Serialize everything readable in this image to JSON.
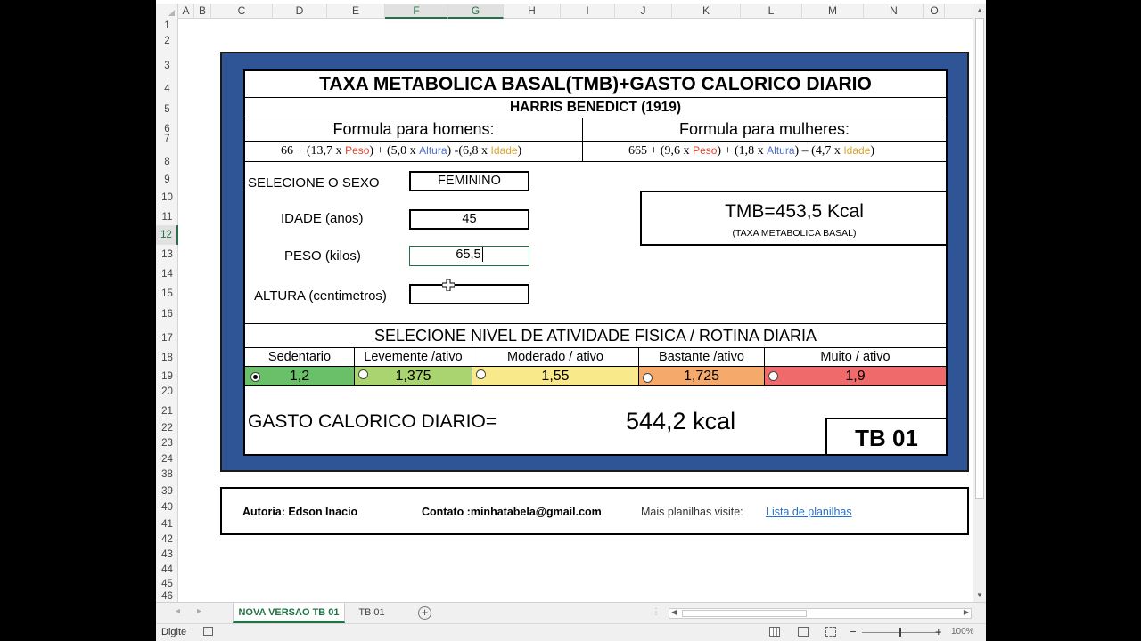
{
  "columns": [
    "A",
    "B",
    "C",
    "D",
    "E",
    "F",
    "G",
    "H",
    "I",
    "J",
    "K",
    "L",
    "M",
    "N",
    "O"
  ],
  "rows": [
    "1",
    "2",
    "3",
    "4",
    "5",
    "6",
    "7",
    "8",
    "9",
    "10",
    "11",
    "12",
    "13",
    "14",
    "15",
    "16",
    "17",
    "18",
    "19",
    "20",
    "21",
    "22",
    "23",
    "24",
    "38",
    "39",
    "40",
    "41",
    "42",
    "43",
    "44",
    "45",
    "46"
  ],
  "sheet": {
    "title": "TAXA METABOLICA BASAL(TMB)+GASTO CALORICO DIARIO",
    "subtitle": "HARRIS BENEDICT (1919)",
    "formula_men_label": "Formula para homens:",
    "formula_women_label": "Formula para mulheres:",
    "formula_men": {
      "p1": "66 + (13,7 x ",
      "peso": "Peso",
      "p2": ") + (5,0 x ",
      "altura": "Altura",
      "p3": ") -(6,8 x ",
      "idade": "Idade",
      "p4": ")"
    },
    "formula_women": {
      "p1": "665 + (9,6 x ",
      "peso": "Peso",
      "p2": ") + (1,8 x ",
      "altura": "Altura",
      "p3": ") – (4,7 x ",
      "idade": "Idade",
      "p4": ")"
    },
    "sex_label": "SELECIONE O SEXO",
    "sex_value": "FEMININO",
    "age_label": "IDADE (anos)",
    "age_value": "45",
    "weight_label": "PESO (kilos)",
    "weight_value": "65,5",
    "height_label": "ALTURA (centimetros)",
    "height_value": "",
    "tmb_result": "TMB=453,5 Kcal",
    "tmb_caption": "(TAXA METABOLICA BASAL)",
    "activity_header": "SELECIONE NIVEL DE ATIVIDADE FISICA / ROTINA DIARIA",
    "activities": [
      {
        "name": "Sedentario",
        "value": "1,2",
        "color": "#6abf69",
        "selected": true
      },
      {
        "name": "Levemente /ativo",
        "value": "1,375",
        "color": "#a9d46f",
        "selected": false
      },
      {
        "name": "Moderado / ativo",
        "value": "1,55",
        "color": "#f8e98a",
        "selected": false
      },
      {
        "name": "Bastante /ativo",
        "value": "1,725",
        "color": "#f5a96b",
        "selected": false
      },
      {
        "name": "Muito / ativo",
        "value": "1,9",
        "color": "#ef6b6b",
        "selected": false
      }
    ],
    "daily_label": "GASTO CALORICO DIARIO=",
    "daily_value": "544,2 kcal",
    "code": "TB 01"
  },
  "footer": {
    "author": "Autoria: Edson Inacio",
    "contact": "Contato :minhatabela@gmail.com",
    "more": "Mais planilhas visite:",
    "link": "Lista de planilhas"
  },
  "tabs": [
    "NOVA VERSAO TB 01",
    "TB 01"
  ],
  "status": {
    "mode": "Digite",
    "zoom": "100%"
  },
  "colors": {
    "frame": "#2f5597",
    "excel_green": "#217346"
  }
}
